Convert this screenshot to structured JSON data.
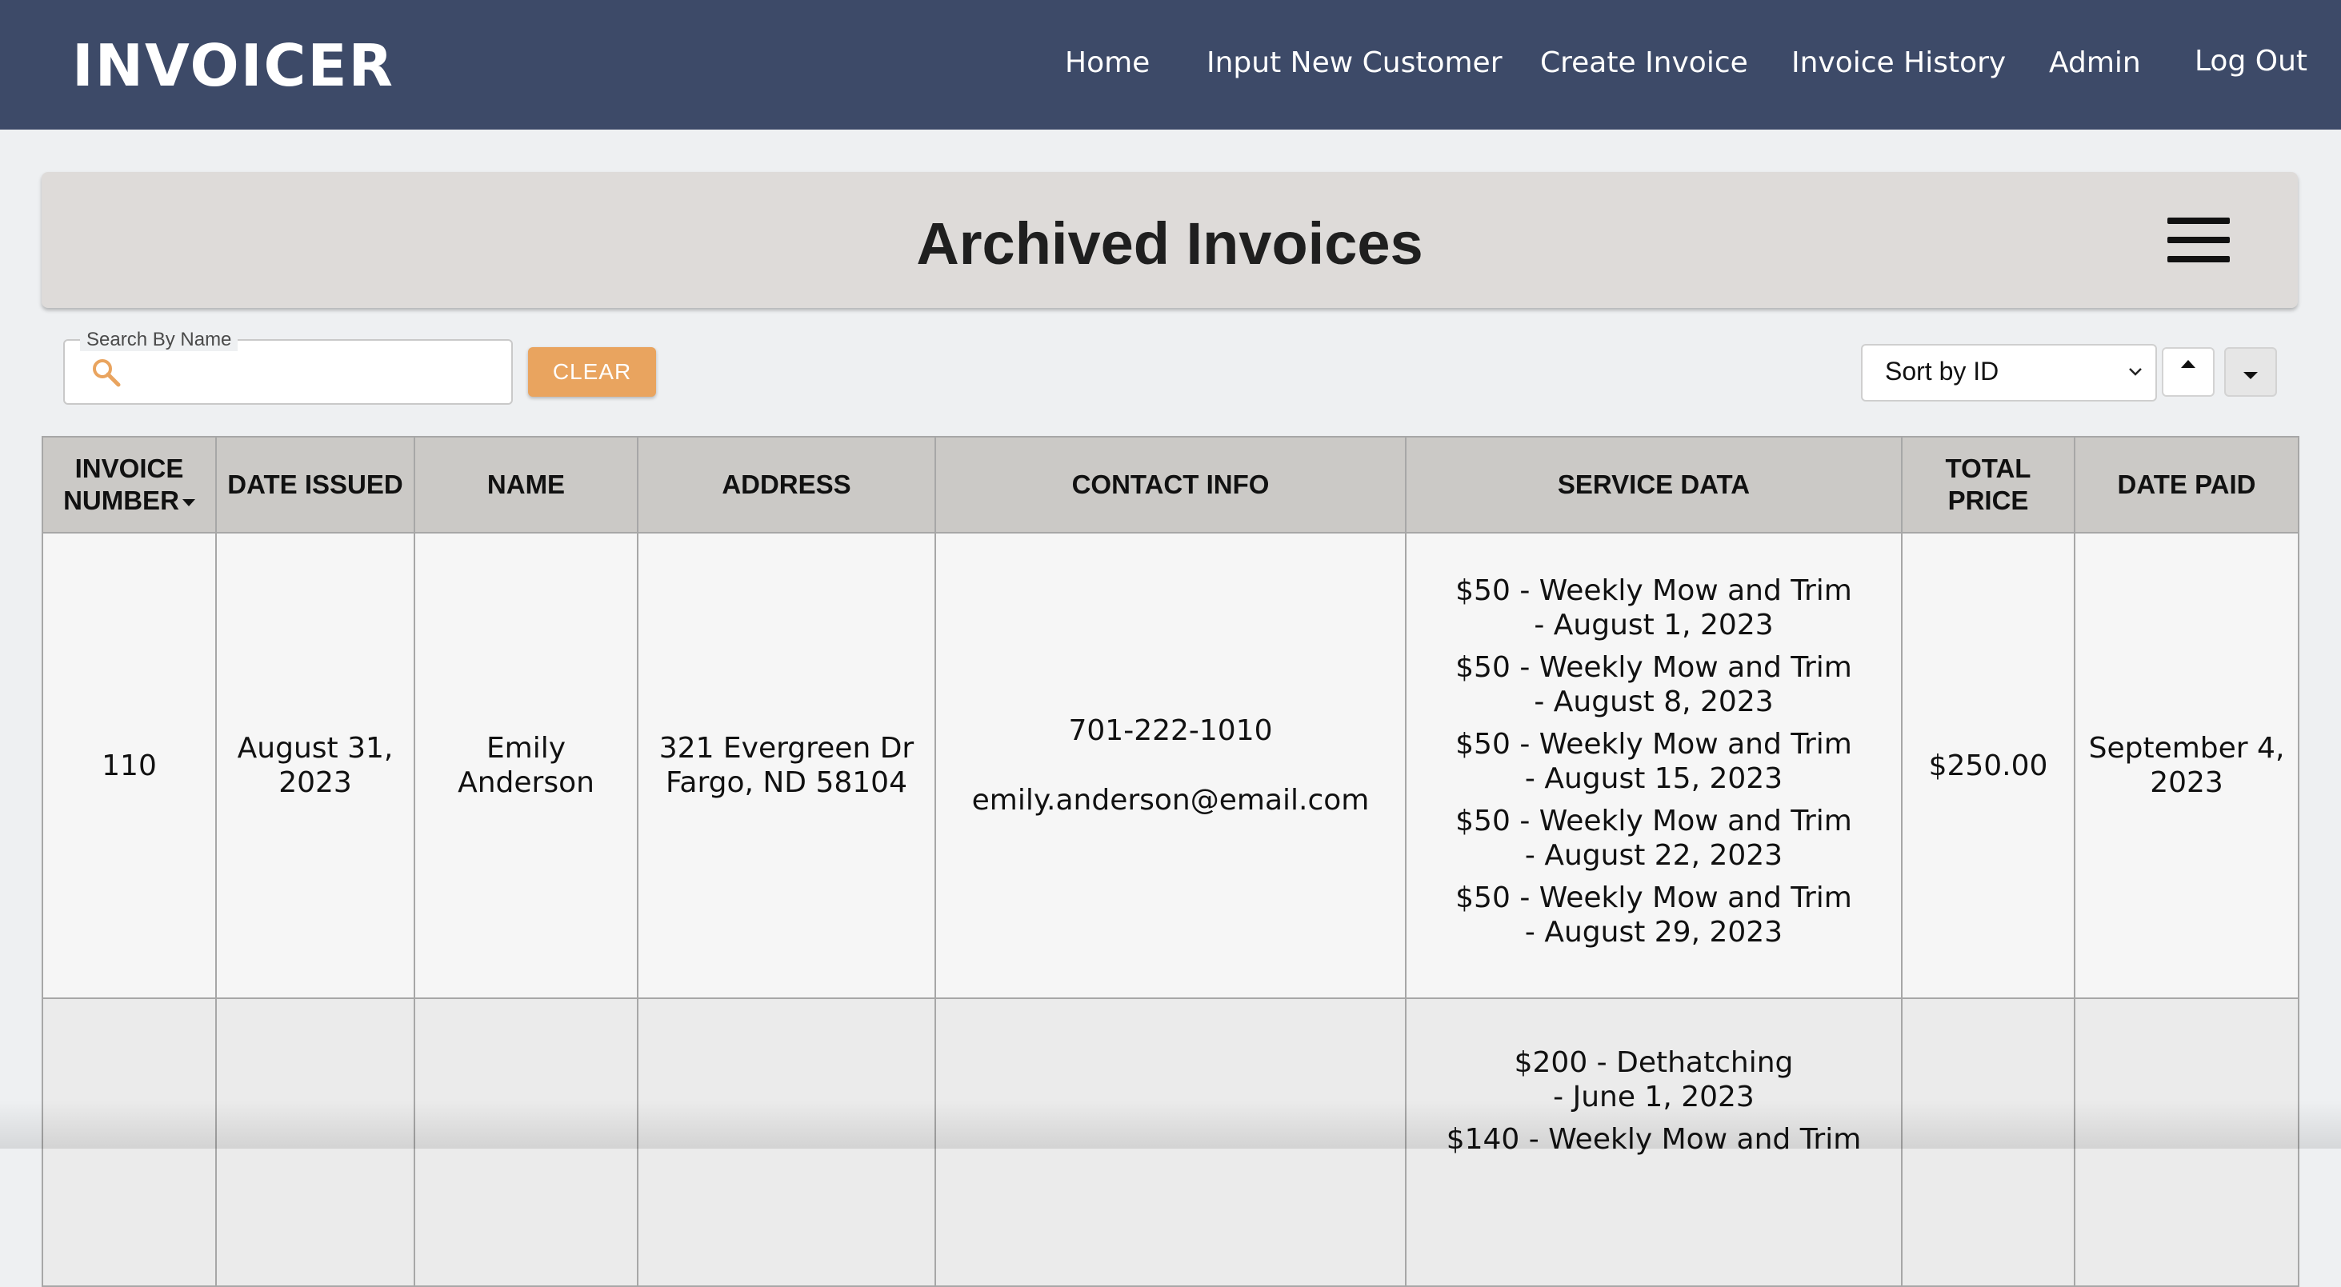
{
  "navbar": {
    "brand": "INVOICER",
    "links": [
      "Home",
      "Input New Customer",
      "Create Invoice",
      "Invoice History",
      "Admin",
      "Log Out"
    ]
  },
  "header": {
    "title": "Archived Invoices"
  },
  "search": {
    "legend": "Search By Name",
    "value": "",
    "clear_label": "CLEAR"
  },
  "sort": {
    "selected": "Sort by ID",
    "direction": "descending"
  },
  "table": {
    "columns": [
      "INVOICE NUMBER",
      "DATE ISSUED",
      "NAME",
      "ADDRESS",
      "CONTACT INFO",
      "SERVICE DATA",
      "TOTAL PRICE",
      "DATE PAID"
    ],
    "rows": [
      {
        "invoice_number": "110",
        "date_issued": "August 31, 2023",
        "name": "Emily Anderson",
        "address_line1": "321 Evergreen Dr",
        "address_line2": "Fargo, ND 58104",
        "phone": "701-222-1010",
        "email": "emily.anderson@email.com",
        "services": [
          {
            "text": "$50 - Weekly Mow and Trim",
            "date": "- August 1, 2023"
          },
          {
            "text": "$50 - Weekly Mow and Trim",
            "date": "- August 8, 2023"
          },
          {
            "text": "$50 - Weekly Mow and Trim",
            "date": "- August 15, 2023"
          },
          {
            "text": "$50 - Weekly Mow and Trim",
            "date": "- August 22, 2023"
          },
          {
            "text": "$50 - Weekly Mow and Trim",
            "date": "- August 29, 2023"
          }
        ],
        "total_price": "$250.00",
        "date_paid": "September 4, 2023"
      },
      {
        "invoice_number": "",
        "date_issued": "",
        "name": "",
        "address_line1": "",
        "address_line2": "",
        "phone": "",
        "email": "",
        "services": [
          {
            "text": "$200 - Dethatching",
            "date": "- June 1, 2023"
          },
          {
            "text": "$140 - Weekly Mow and Trim",
            "date": ""
          }
        ],
        "total_price": "",
        "date_paid": ""
      }
    ]
  }
}
